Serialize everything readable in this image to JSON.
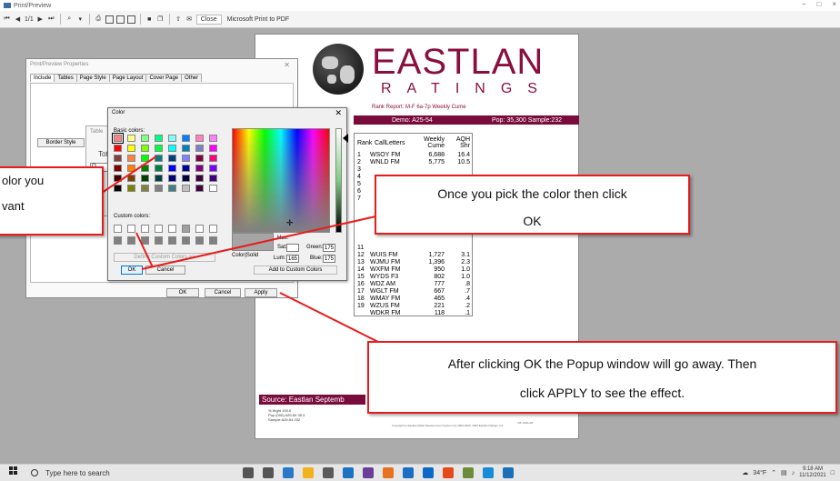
{
  "window": {
    "title": "Print/Preview",
    "controls": [
      "−",
      "□",
      "×"
    ]
  },
  "toolbar": {
    "page_indicator": "1/1",
    "close_label": "Close",
    "printer": "Microsoft Print to PDF"
  },
  "report": {
    "brand": "EASTLAN",
    "brand_sub": "RATINGS",
    "report_line": "Rank Report: M-F 6a-7p  Weekly Cume",
    "demo": "Demo: A25-54",
    "pop": "Pop: 35,300  Sample:232",
    "table_headers": {
      "rank": "Rank",
      "call": "CallLetters",
      "cume_top": "Weekly",
      "cume_bottom": "Cume",
      "shr_top": "AQH",
      "shr_bottom": "Shr"
    },
    "rows_top": [
      {
        "rank": "1",
        "call": "WSOY FM",
        "cume": "6,688",
        "shr": "16.4"
      },
      {
        "rank": "2",
        "call": "WNLD FM",
        "cume": "5,775",
        "shr": "10.5"
      },
      {
        "rank": "3",
        "call": "",
        "cume": "",
        "shr": ""
      },
      {
        "rank": "4",
        "call": "",
        "cume": "",
        "shr": ""
      },
      {
        "rank": "5",
        "call": "",
        "cume": "",
        "shr": ""
      },
      {
        "rank": "6",
        "call": "",
        "cume": "",
        "shr": ""
      },
      {
        "rank": "7",
        "call": "",
        "cume": "",
        "shr": ""
      }
    ],
    "rows_bottom": [
      {
        "rank": "11",
        "call": "",
        "cume": "",
        "shr": ""
      },
      {
        "rank": "12",
        "call": "WUIS FM",
        "cume": "1,727",
        "shr": "3.1"
      },
      {
        "rank": "13",
        "call": "WJMU FM",
        "cume": "1,396",
        "shr": "2.3"
      },
      {
        "rank": "14",
        "call": "WXFM FM",
        "cume": "950",
        "shr": "1.0"
      },
      {
        "rank": "15",
        "call": "WYDS F3",
        "cume": "802",
        "shr": "1.0"
      },
      {
        "rank": "16",
        "call": "WDZ  AM",
        "cume": "777",
        "shr": ".8"
      },
      {
        "rank": "17",
        "call": "WGLT FM",
        "cume": "667",
        "shr": ".7"
      },
      {
        "rank": "18",
        "call": "WMAY FM",
        "cume": "465",
        "shr": ".4"
      },
      {
        "rank": "19",
        "call": "WZUS FM",
        "cume": "221",
        "shr": ".2"
      },
      {
        "rank": "",
        "call": "WDKR FM",
        "cume": "118",
        "shr": ".1"
      }
    ],
    "source": "Source: Eastlan Septemb",
    "footer_left": [
      "% Wght   100.0",
      "Pop (000)  A25-54   35.3",
      "Sample    A25-54    232"
    ],
    "footer_center": "Copyright by Eastlan Radio Measurement System (C) 2003-2020. 2020 Eastlan Ratings, Inc.",
    "footer_right": "FB: 2021-08"
  },
  "props_dialog": {
    "title": "Print/Preview Properties",
    "tabs": [
      "Include",
      "Tables",
      "Page Style",
      "Page Layout",
      "Cover Page",
      "Other"
    ],
    "border_style": "Border Style",
    "ok": "OK",
    "cancel": "Cancel",
    "apply": "Apply"
  },
  "table_dialog": {
    "title": "Table",
    "label": "Tot",
    "input": "O"
  },
  "color_dialog": {
    "title": "Color",
    "basic_label": "Basic colors:",
    "custom_label": "Custom colors:",
    "define_custom": "Define Custom Colors >>",
    "ok": "OK",
    "cancel": "Cancel",
    "color_solid": "Color|Solid",
    "hue_label": "Hue:",
    "sat_label": "Sat:",
    "lum_label": "Lum:",
    "lum_value": "165",
    "red_label": "Red:",
    "green_label": "Green:",
    "blue_label": "Blue:",
    "red_value": "",
    "green_value": "175",
    "blue_value": "175",
    "add_custom": "Add to Custom Colors",
    "basic_colors": [
      "#ff8080",
      "#ffff80",
      "#80ff80",
      "#00ff80",
      "#80ffff",
      "#0080ff",
      "#ff80c0",
      "#ff80ff",
      "#ff0000",
      "#ffff00",
      "#80ff00",
      "#00ff40",
      "#00ffff",
      "#0080c0",
      "#8080c0",
      "#ff00ff",
      "#804040",
      "#ff8040",
      "#00ff00",
      "#008080",
      "#004080",
      "#8080ff",
      "#800040",
      "#ff0080",
      "#800000",
      "#ff8000",
      "#008000",
      "#008040",
      "#0000ff",
      "#0000a0",
      "#800080",
      "#8000ff",
      "#400000",
      "#804000",
      "#004000",
      "#004040",
      "#000080",
      "#000040",
      "#400040",
      "#400080",
      "#000000",
      "#808000",
      "#808040",
      "#808080",
      "#408080",
      "#c0c0c0",
      "#400040",
      "#ffffff"
    ],
    "custom_colors": [
      "#ffffff",
      "#ffffff",
      "#ffffff",
      "#ffffff",
      "#ffffff",
      "#a0a0a0",
      "#ffffff",
      "#ffffff",
      "#808080",
      "#808080",
      "#808080",
      "#808080",
      "#808080",
      "#808080",
      "#808080",
      "#808080"
    ]
  },
  "callouts": {
    "left": [
      "olor  you",
      "vant"
    ],
    "mid": [
      "Once you pick the color then click",
      "OK"
    ],
    "bottom": [
      "After clicking OK the Popup window will go away.  Then",
      "click APPLY to see the effect."
    ]
  },
  "taskbar": {
    "search_placeholder": "Type here to search",
    "weather": "34°F",
    "time": "9:18 AM",
    "date": "11/12/2021",
    "app_colors": [
      "#555555",
      "#555555",
      "#2a79c9",
      "#f2b21b",
      "#5a5a5a",
      "#1b71c4",
      "#6b3d99",
      "#e5731d",
      "#1b6ec2",
      "#0b6ac8",
      "#e64a19",
      "#6c8c3c",
      "#168bd8",
      "#1a6fb8"
    ]
  }
}
